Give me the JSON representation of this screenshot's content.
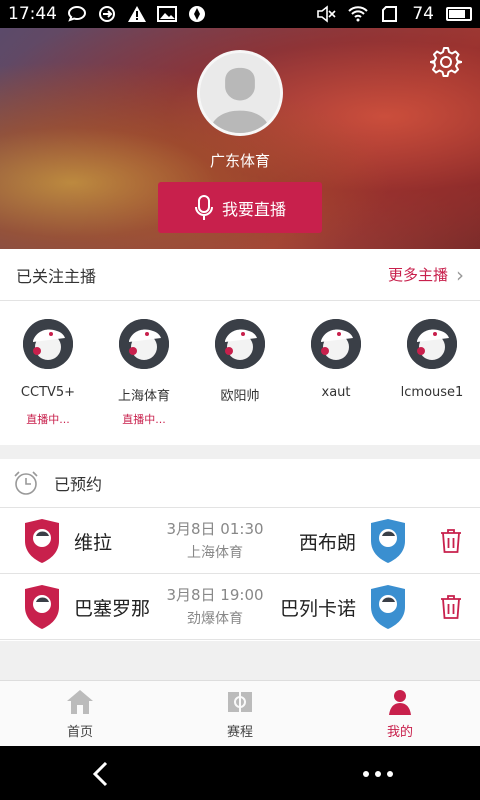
{
  "status_bar": {
    "time": "17:44",
    "battery": "74",
    "left_icons": [
      "chat-bubble-icon",
      "sync-icon",
      "warning-icon",
      "image-icon",
      "vpn-icon"
    ],
    "right_icons": [
      "mute-icon",
      "wifi-icon",
      "sim-icon",
      "battery-icon"
    ]
  },
  "profile": {
    "username": "广东体育",
    "live_button_label": "我要直播",
    "settings_icon": "gear-icon"
  },
  "following": {
    "title": "已关注主播",
    "more_label": "更多主播",
    "streamers": [
      {
        "name": "CCTV5+",
        "status": "直播中..."
      },
      {
        "name": "上海体育",
        "status": "直播中..."
      },
      {
        "name": "欧阳帅",
        "status": ""
      },
      {
        "name": "xaut",
        "status": ""
      },
      {
        "name": "lcmouse1",
        "status": ""
      }
    ]
  },
  "booked": {
    "title": "已预约",
    "matches": [
      {
        "home": "维拉",
        "away": "西布朗",
        "time": "3月8日  01:30",
        "channel": "上海体育"
      },
      {
        "home": "巴塞罗那",
        "away": "巴列卡诺",
        "time": "3月8日  19:00",
        "channel": "劲爆体育"
      }
    ]
  },
  "tabs": [
    {
      "label": "首页",
      "icon": "home-icon"
    },
    {
      "label": "赛程",
      "icon": "schedule-icon"
    },
    {
      "label": "我的",
      "icon": "profile-icon",
      "active": true
    }
  ],
  "colors": {
    "accent": "#c8204c",
    "home_badge": "#c8204c",
    "away_badge": "#3a8fd0"
  }
}
